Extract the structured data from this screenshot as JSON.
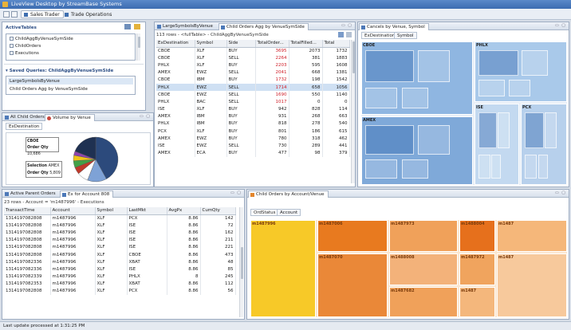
{
  "app": {
    "title": "LiveView Desktop by StreamBase Systems"
  },
  "toolbar": {
    "tabs": [
      "Sales Trader",
      "Trade Operations"
    ]
  },
  "active_tables": {
    "title": "ActiveTables",
    "items": [
      "ChildAggByVenueSymSide",
      "ChildOrders",
      "Executions"
    ],
    "saved_title": "Saved Queries: ChildAggByVenueSymSide",
    "saved_items": [
      "LargeSymbolsByVenue",
      "Child Orders Agg by VenueSymSide"
    ]
  },
  "venue_chart": {
    "tabs": [
      "All Child Orders",
      "Volume by Venue"
    ],
    "subtab": "ExDestination",
    "tooltip1": {
      "name": "CBOE",
      "label": "Order Qty",
      "value": "10,686"
    },
    "tooltip2": {
      "label1": "Selection",
      "value1": "AMEX",
      "label2": "Order Qty",
      "value2": "5,809"
    },
    "colors": [
      "#2c4a7c",
      "#7ea2d6",
      "#ffffff",
      "#c0392b",
      "#43a047",
      "#f0c419",
      "#8e44ad",
      "#1f3152"
    ],
    "slices": [
      42,
      14,
      8,
      5,
      5,
      4,
      3,
      19
    ]
  },
  "child_agg": {
    "tabs": [
      "LargeSymbolsByVenue",
      "Child Orders Agg by VenueSymSide"
    ],
    "subtitle": "113 rows - <fullTable> - ChildAggByVenueSymSide",
    "columns": [
      "ExDestination",
      "Symbol",
      "Side",
      "TotalOrder...",
      "TotalFilled...",
      "Total"
    ],
    "rows": [
      [
        "CBOE",
        "XLF",
        "BUY",
        "3695",
        "2073",
        "1732"
      ],
      [
        "CBOE",
        "XLF",
        "SELL",
        "2264",
        "381",
        "1883"
      ],
      [
        "PHLX",
        "XLF",
        "BUY",
        "2203",
        "595",
        "1608"
      ],
      [
        "AMEX",
        "EWZ",
        "SELL",
        "2041",
        "668",
        "1381"
      ],
      [
        "CBOE",
        "IBM",
        "BUY",
        "1732",
        "198",
        "1542"
      ],
      [
        "PHLX",
        "EWZ",
        "SELL",
        "1714",
        "658",
        "1056"
      ],
      [
        "CBOE",
        "EWZ",
        "SELL",
        "1690",
        "550",
        "1140"
      ],
      [
        "PHLX",
        "BAC",
        "SELL",
        "1017",
        "0",
        "0"
      ],
      [
        "ISE",
        "XLF",
        "BUY",
        "942",
        "828",
        "114"
      ],
      [
        "AMEX",
        "IBM",
        "BUY",
        "931",
        "268",
        "663"
      ],
      [
        "PHLX",
        "IBM",
        "BUY",
        "818",
        "278",
        "540"
      ],
      [
        "PCX",
        "XLF",
        "BUY",
        "801",
        "186",
        "615"
      ],
      [
        "AMEX",
        "EWZ",
        "BUY",
        "780",
        "318",
        "462"
      ],
      [
        "ISE",
        "EWZ",
        "SELL",
        "730",
        "289",
        "441"
      ],
      [
        "AMEX",
        "ECA",
        "BUY",
        "477",
        "98",
        "379"
      ]
    ],
    "hot_rows": [
      0,
      1,
      2,
      3,
      4,
      5,
      6,
      7
    ],
    "selected_row": 5
  },
  "cancels": {
    "tabs": [
      "Cancels by Venue, Symbol"
    ],
    "subtabs": [
      "ExDestination",
      "Symbol"
    ],
    "venues": [
      "CBOE",
      "PHLX",
      "AMEX",
      "ISE",
      "PCX"
    ]
  },
  "exec": {
    "tabs": [
      "Active Parent Orders",
      "Ex for Account 808"
    ],
    "subtitle": "23 rows - Account = 'm1487996' - Executions",
    "columns": [
      "TransactTime",
      "Account",
      "Symbol",
      "LastMkt",
      "AvgPx",
      "CumQty"
    ],
    "rows": [
      [
        "1314197082808",
        "m1487996",
        "XLF",
        "PCX",
        "8.86",
        "142"
      ],
      [
        "1314197082808",
        "m1487996",
        "XLF",
        "ISE",
        "8.86",
        "72"
      ],
      [
        "1314197082808",
        "m1487996",
        "XLF",
        "ISE",
        "8.86",
        "162"
      ],
      [
        "1314197082808",
        "m1487996",
        "XLF",
        "ISE",
        "8.86",
        "211"
      ],
      [
        "1314197082808",
        "m1487996",
        "XLF",
        "ISE",
        "8.86",
        "221"
      ],
      [
        "1314197082808",
        "m1487996",
        "XLF",
        "CBOE",
        "8.86",
        "473"
      ],
      [
        "1314197082336",
        "m1487996",
        "XLF",
        "XBAT",
        "8.86",
        "48"
      ],
      [
        "1314197082336",
        "m1487996",
        "XLF",
        "ISE",
        "8.86",
        "85"
      ],
      [
        "1314197082339",
        "m1487996",
        "XLF",
        "PHLX",
        "8",
        "245"
      ],
      [
        "1314197082353",
        "m1487996",
        "XLF",
        "XBAT",
        "8.86",
        "112"
      ],
      [
        "1314197082808",
        "m1487996",
        "XLF",
        "PCX",
        "8.86",
        "56"
      ]
    ]
  },
  "child_by_account": {
    "tabs": [
      "Child Orders by Account/Venue"
    ],
    "subtabs": [
      "OrdStatus",
      "Account"
    ],
    "cells": [
      {
        "t": "m1487996",
        "v": "",
        "c": "#f7c928"
      },
      {
        "t": "m1487006",
        "v": "",
        "c": "#e87a1f"
      },
      {
        "t": "m1487973",
        "v": "",
        "c": "#f0a15a"
      },
      {
        "t": "m1488004",
        "v": "",
        "c": "#e6701c"
      },
      {
        "t": "m1487",
        "v": "",
        "c": "#f5b77a"
      },
      {
        "t": "m1487",
        "v": "",
        "c": "#f7c99c"
      },
      {
        "t": "m1488008",
        "v": "",
        "c": "#f3b27a"
      },
      {
        "t": "m1487070",
        "v": "",
        "c": "#ea8838"
      },
      {
        "t": "m1487682",
        "v": "",
        "c": "#f0a15a"
      },
      {
        "t": "m1487972",
        "v": "",
        "c": "#f0a45e"
      },
      {
        "t": "m1487",
        "v": "",
        "c": "#f4b77c"
      }
    ]
  },
  "status": {
    "text": "Last update processed at 1:31:25 PM"
  }
}
